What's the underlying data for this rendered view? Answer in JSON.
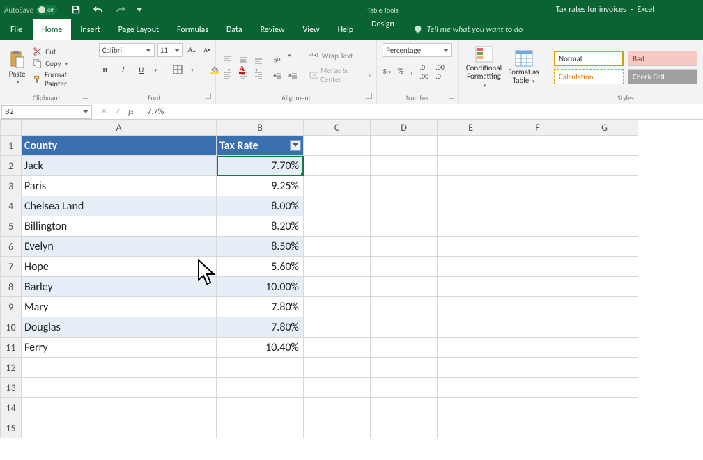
{
  "titlebar": {
    "autosave_label": "AutoSave",
    "autosave_state": "Off",
    "doc_name": "Tax rates for invoices",
    "app_name": "Excel",
    "table_tools_label": "Table Tools"
  },
  "tabs": {
    "file": "File",
    "home": "Home",
    "insert": "Insert",
    "page_layout": "Page Layout",
    "formulas": "Formulas",
    "data": "Data",
    "review": "Review",
    "view": "View",
    "help": "Help",
    "design": "Design",
    "tell_me": "Tell me what you want to do"
  },
  "ribbon": {
    "clipboard": {
      "label": "Clipboard",
      "paste": "Paste",
      "cut": "Cut",
      "copy": "Copy",
      "format_painter": "Format Painter"
    },
    "font": {
      "label": "Font",
      "name": "Calibri",
      "size": "11"
    },
    "alignment": {
      "label": "Alignment",
      "wrap": "Wrap Text",
      "merge": "Merge & Center"
    },
    "number": {
      "label": "Number",
      "format": "Percentage"
    },
    "cf": {
      "line1": "Conditional",
      "line2": "Formatting"
    },
    "fat": {
      "line1": "Format as",
      "line2": "Table"
    },
    "styles": {
      "label": "Styles",
      "normal": "Normal",
      "bad": "Bad",
      "calculation": "Calculation",
      "check_cell": "Check Cell"
    }
  },
  "formula_bar": {
    "cell_ref": "B2",
    "value": "7.7%"
  },
  "grid": {
    "columns": [
      "A",
      "B",
      "C",
      "D",
      "E",
      "F",
      "G"
    ],
    "header": {
      "county": "County",
      "tax_rate": "Tax Rate"
    },
    "rows": [
      {
        "county": "Jack",
        "rate": "7.70%"
      },
      {
        "county": "Paris",
        "rate": "9.25%"
      },
      {
        "county": "Chelsea Land",
        "rate": "8.00%"
      },
      {
        "county": "Billington",
        "rate": "8.20%"
      },
      {
        "county": "Evelyn",
        "rate": "8.50%"
      },
      {
        "county": "Hope",
        "rate": "5.60%"
      },
      {
        "county": "Barley",
        "rate": "10.00%"
      },
      {
        "county": "Mary",
        "rate": "7.80%"
      },
      {
        "county": "Douglas",
        "rate": "7.80%"
      },
      {
        "county": "Ferry",
        "rate": "10.40%"
      }
    ]
  },
  "chart_data": {
    "type": "table",
    "title": "Tax rates for invoices",
    "columns": [
      "County",
      "Tax Rate"
    ],
    "rows": [
      [
        "Jack",
        0.077
      ],
      [
        "Paris",
        0.0925
      ],
      [
        "Chelsea Land",
        0.08
      ],
      [
        "Billington",
        0.082
      ],
      [
        "Evelyn",
        0.085
      ],
      [
        "Hope",
        0.056
      ],
      [
        "Barley",
        0.1
      ],
      [
        "Mary",
        0.078
      ],
      [
        "Douglas",
        0.078
      ],
      [
        "Ferry",
        0.104
      ]
    ]
  }
}
